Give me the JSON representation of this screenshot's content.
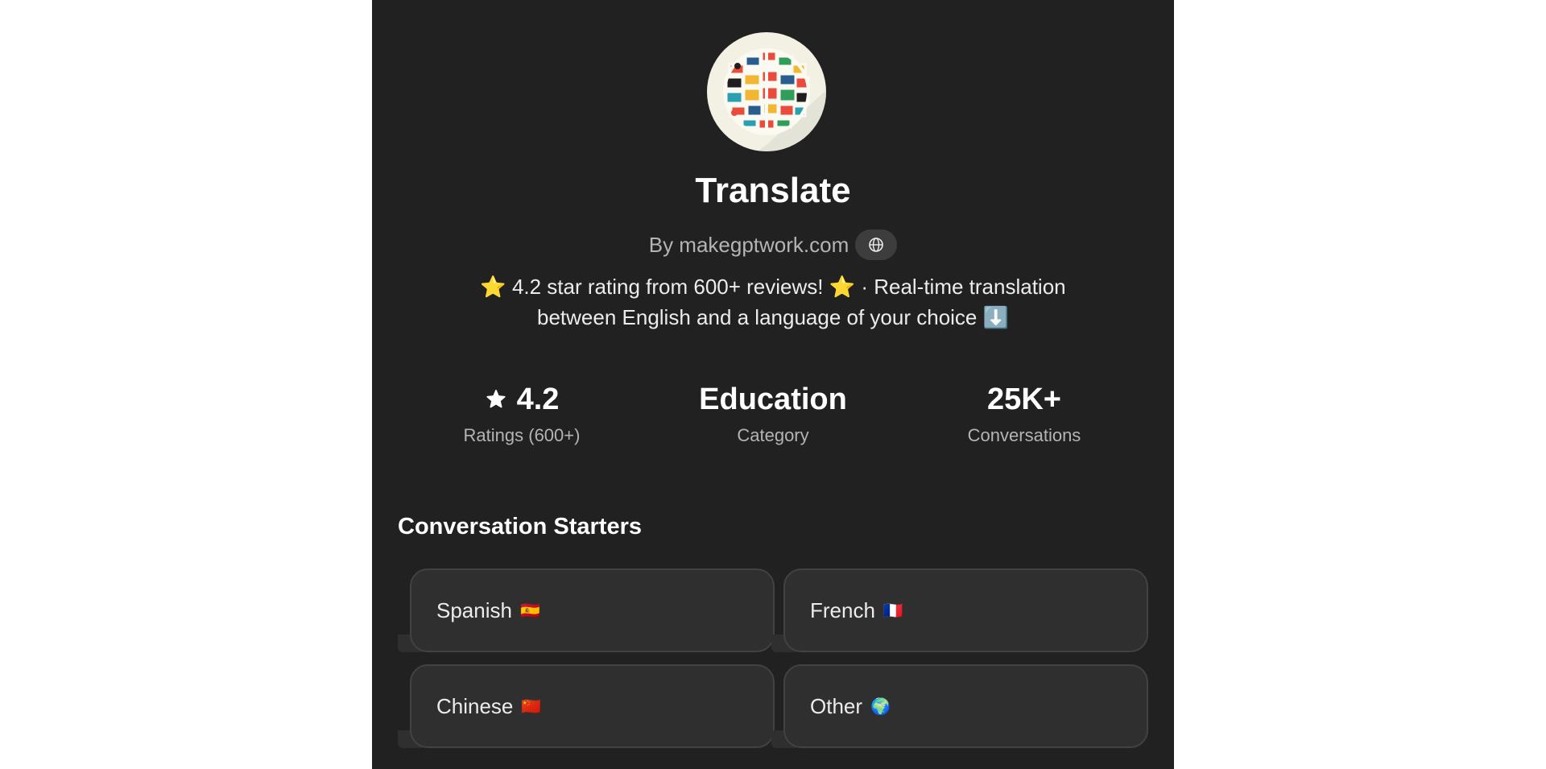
{
  "gpt": {
    "name": "Translate",
    "author": "By makegptwork.com",
    "description": "⭐ 4.2 star rating from 600+ reviews! ⭐ · Real-time translation between English and a language of your choice ⬇️"
  },
  "stats": [
    {
      "value": "4.2",
      "label": "Ratings (600+)",
      "icon": "star-icon"
    },
    {
      "value": "Education",
      "label": "Category"
    },
    {
      "value": "25K+",
      "label": "Conversations"
    }
  ],
  "starters_section": {
    "title": "Conversation Starters",
    "items": [
      {
        "label": "Spanish",
        "flag": "🇪🇸"
      },
      {
        "label": "French",
        "flag": "🇫🇷"
      },
      {
        "label": "Chinese",
        "flag": "🇨🇳"
      },
      {
        "label": "Other",
        "flag": "🌍"
      }
    ]
  },
  "colors": {
    "panel_bg": "#212121",
    "card_bg": "#2f2f2f",
    "card_border": "#424242",
    "muted_text": "#b4b4b4"
  }
}
